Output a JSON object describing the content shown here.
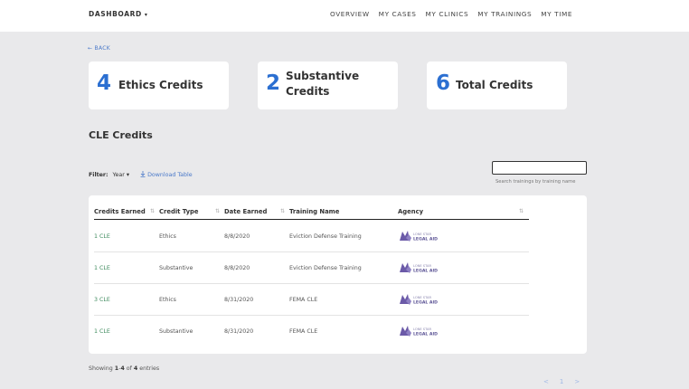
{
  "header": {
    "brand": "DASHBOARD",
    "nav": [
      "OVERVIEW",
      "MY CASES",
      "MY CLINICS",
      "MY TRAININGS",
      "MY TIME"
    ]
  },
  "back_label": "← BACK",
  "summary": [
    {
      "value": "4",
      "label": "Ethics Credits"
    },
    {
      "value": "2",
      "label": "Substantive Credits"
    },
    {
      "value": "6",
      "label": "Total Credits"
    }
  ],
  "section_title": "CLE Credits",
  "filter": {
    "label": "Filter:",
    "value": "Year",
    "download": "Download Table"
  },
  "search": {
    "hint": "Search trainings by training name",
    "value": ""
  },
  "table": {
    "columns": [
      "Credits Earned",
      "Credit Type",
      "Date Earned",
      "Training Name",
      "Agency"
    ],
    "rows": [
      {
        "credits": "1 CLE",
        "type": "Ethics",
        "date": "8/8/2020",
        "training": "Eviction Defense Training",
        "agency": "LONE STAR LEGAL AID"
      },
      {
        "credits": "1 CLE",
        "type": "Substantive",
        "date": "8/8/2020",
        "training": "Eviction Defense Training",
        "agency": "LONE STAR LEGAL AID"
      },
      {
        "credits": "3 CLE",
        "type": "Ethics",
        "date": "8/31/2020",
        "training": "FEMA CLE",
        "agency": "LONE STAR LEGAL AID"
      },
      {
        "credits": "1 CLE",
        "type": "Substantive",
        "date": "8/31/2020",
        "training": "FEMA CLE",
        "agency": "LONE STAR LEGAL AID"
      }
    ]
  },
  "footer": {
    "showing_prefix": "Showing ",
    "range_start": "1",
    "range_sep": "-",
    "range_end": "4",
    "of": " of ",
    "total": "4",
    "suffix": " entries"
  },
  "pager": {
    "prev": "<",
    "page": "1",
    "next": ">"
  },
  "colors": {
    "accent": "#2b6fd1",
    "link": "#4a79c9",
    "credits": "#3d8a5c",
    "logo": "#6b5aa8"
  }
}
